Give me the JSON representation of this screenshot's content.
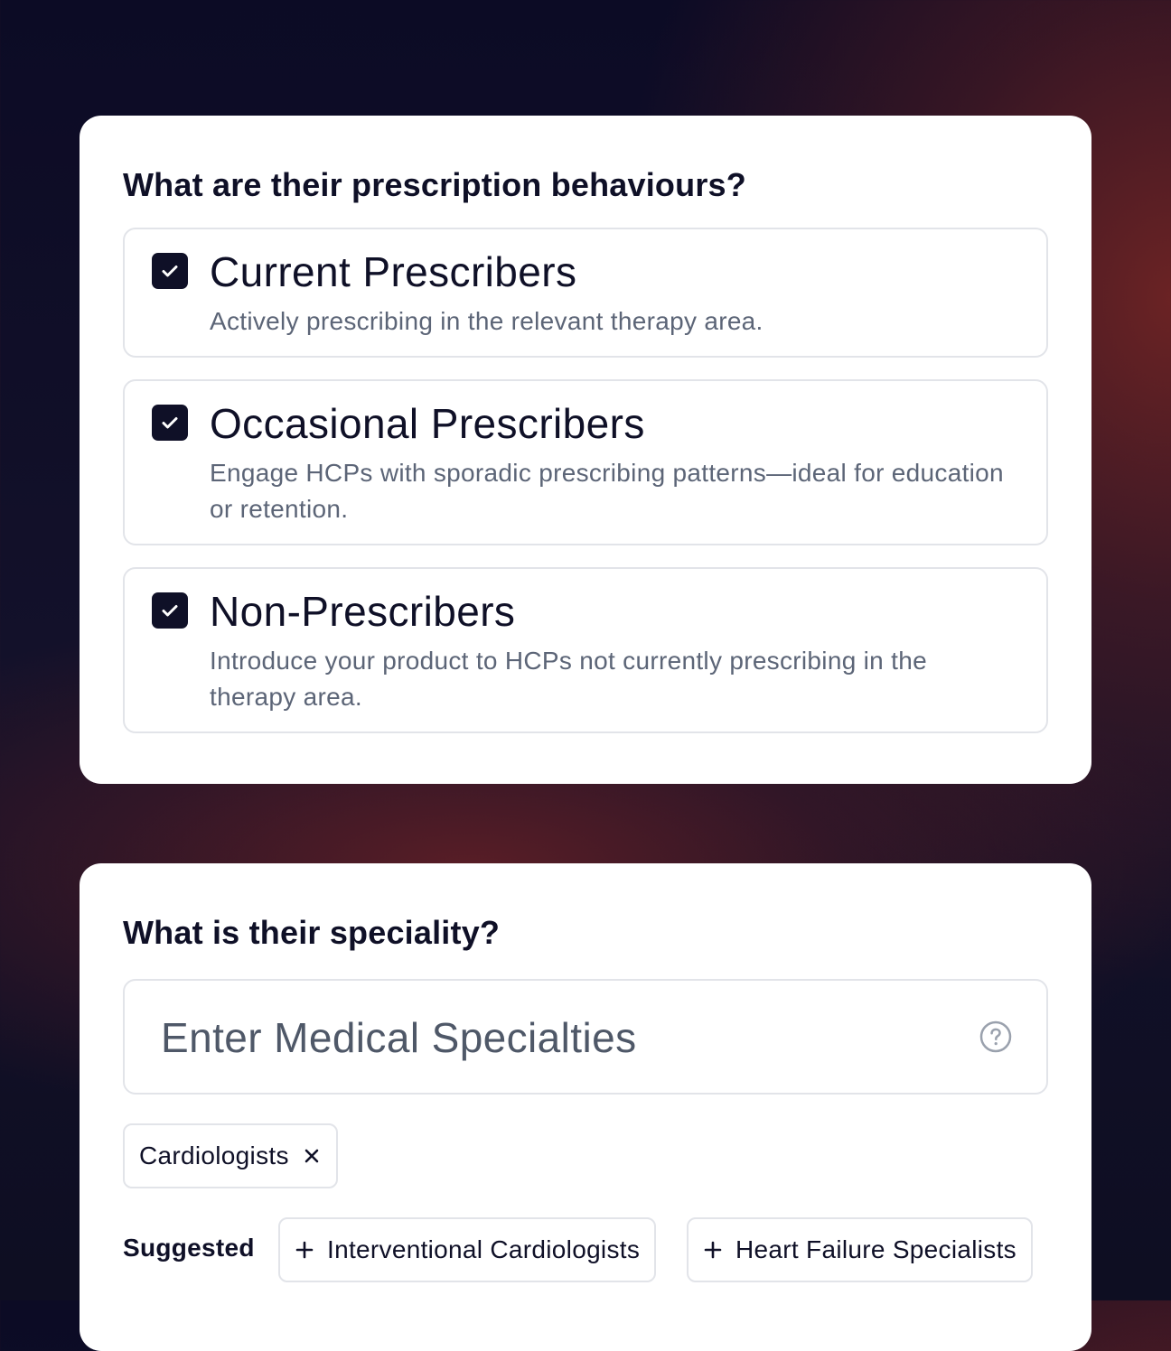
{
  "behaviours": {
    "title": "What are their prescription behaviours?",
    "options": [
      {
        "label": "Current Prescribers",
        "description": "Actively prescribing in the relevant therapy area.",
        "checked": true
      },
      {
        "label": "Occasional Prescribers",
        "description": "Engage HCPs with sporadic prescribing patterns—ideal for education or retention.",
        "checked": true
      },
      {
        "label": "Non-Prescribers",
        "description": "Introduce your product to HCPs not currently prescribing in the therapy area.",
        "checked": true
      }
    ]
  },
  "speciality": {
    "title": "What is their speciality?",
    "input": {
      "placeholder": "Enter Medical Specialties",
      "value": ""
    },
    "selected": [
      {
        "label": "Cardiologists"
      }
    ],
    "suggested_label": "Suggested",
    "suggested": [
      {
        "label": "Interventional Cardiologists"
      },
      {
        "label": "Heart Failure Specialists"
      }
    ]
  },
  "colors": {
    "ink": "#0f1027",
    "muted_text": "#5c6577",
    "border": "#e2e4e9",
    "card": "#ffffff"
  }
}
